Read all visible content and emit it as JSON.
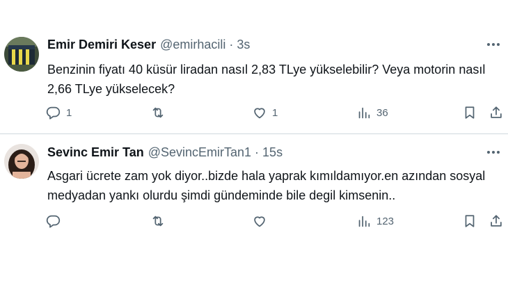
{
  "tweets": [
    {
      "name": "Emir Demiri Keser",
      "handle": "@emirhacili",
      "separator": "·",
      "time": "3s",
      "text": "Benzinin fiyatı 40 küsür liradan nasıl 2,83 TLye yükselebilir? Veya motorin nasıl 2,66 TLye yükselecek?",
      "reply_count": "1",
      "retweet_count": "",
      "like_count": "1",
      "view_count": "36"
    },
    {
      "name": "Sevinc Emir Tan",
      "handle": "@SevincEmirTan1",
      "separator": "·",
      "time": "15s",
      "text": "Asgari ücrete zam yok diyor..bizde hala yaprak kımıldamıyor.en azından sosyal medyadan yankı olurdu şimdi gündeminde bile degil kimsenin..",
      "reply_count": "",
      "retweet_count": "",
      "like_count": "",
      "view_count": "123"
    }
  ],
  "icons": {
    "reply": "reply-icon",
    "retweet": "retweet-icon",
    "like": "heart-icon",
    "views": "views-icon",
    "bookmark": "bookmark-icon",
    "share": "share-icon",
    "more": "more-icon"
  },
  "colors": {
    "text": "#0f1419",
    "secondary": "#536471",
    "divider": "#cfd9de"
  }
}
